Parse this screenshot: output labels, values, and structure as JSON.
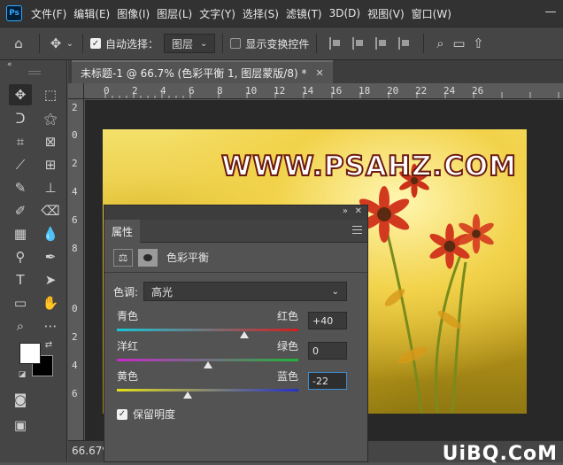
{
  "app": {
    "logo": "Ps"
  },
  "menu": [
    "文件(F)",
    "编辑(E)",
    "图像(I)",
    "图层(L)",
    "文字(Y)",
    "选择(S)",
    "滤镜(T)",
    "3D(D)",
    "视图(V)",
    "窗口(W)"
  ],
  "options": {
    "auto_select_label": "自动选择：",
    "auto_select_checked": true,
    "target_value": "图层",
    "show_transform_label": "显示变换控件",
    "show_transform_checked": false
  },
  "document": {
    "tab_title": "未标题-1 @ 66.7% (色彩平衡 1, 图层蒙版/8) *",
    "zoom": "66.67%"
  },
  "rulers": {
    "h_labels": [
      "0",
      "2",
      "4",
      "6",
      "8",
      "10",
      "12",
      "14",
      "16",
      "18",
      "20",
      "22",
      "24",
      "26"
    ],
    "v_labels": [
      "2",
      "0",
      "2",
      "4",
      "6",
      "8",
      "0",
      "2",
      "4",
      "6"
    ]
  },
  "photo": {
    "watermark": "WWW.PSAHZ.COM"
  },
  "properties": {
    "tab_label": "属性",
    "adjustment_title": "色彩平衡",
    "tone_label": "色调:",
    "tone_value": "高光",
    "sliders": [
      {
        "left": "青色",
        "right": "红色",
        "value": "+40",
        "level": 40
      },
      {
        "left": "洋红",
        "right": "绿色",
        "value": "0",
        "level": 0
      },
      {
        "left": "黄色",
        "right": "蓝色",
        "value": "-22",
        "level": -22
      }
    ],
    "preserve_label": "保留明度",
    "preserve_checked": true
  },
  "site_watermark": "UiBQ.CoM",
  "colors": {
    "foreground": "#ffffff",
    "background": "#000000",
    "accent": "#31a8ff"
  }
}
